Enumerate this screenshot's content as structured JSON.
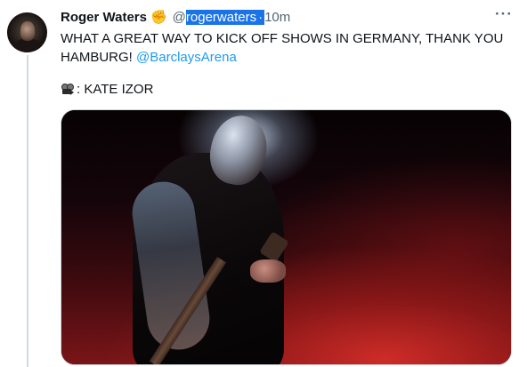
{
  "tweet": {
    "author_name": "Roger Waters",
    "verified_icon": "verified-badge-icon",
    "handle_prefix": "@",
    "handle": "rogerwaters",
    "separator": "·",
    "time": "10m",
    "more_icon": "more-options-icon",
    "text_main": "WHAT A GREAT WAY TO KICK OFF SHOWS IN GERMANY, THANK YOU HAMBURG! ",
    "mention": "@BarclaysArena",
    "credit_icon": "movie-camera-icon",
    "credit_text": ": KATE IZOR",
    "media_icon": "concert-video-thumbnail"
  },
  "colors": {
    "link": "#1d9bf0",
    "muted": "#536471",
    "selection": "#1a73e8",
    "text": "#0f1419",
    "verified": "#f5c542"
  }
}
